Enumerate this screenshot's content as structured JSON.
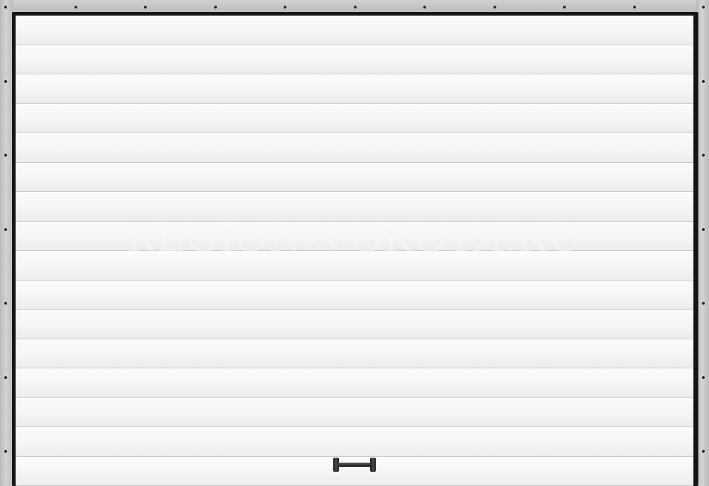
{
  "scene": {
    "subject": "sectional-garage-door",
    "watermark_text": "REGION-VOROTA.RU",
    "colors": {
      "frame": "#c4c4c4",
      "seal": "#151515",
      "panel": "#f5f5f5",
      "handle": "#1f1f1f"
    },
    "panel_count": 16
  }
}
